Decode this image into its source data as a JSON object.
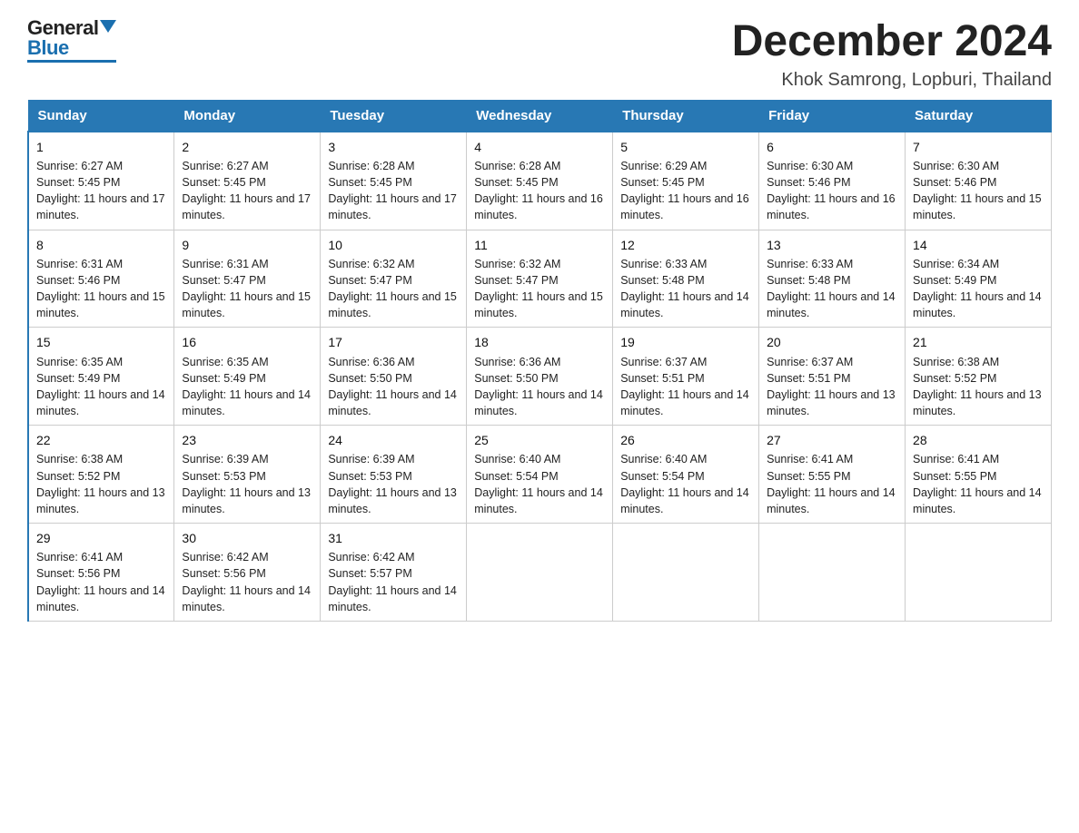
{
  "logo": {
    "general": "General",
    "blue": "Blue"
  },
  "header": {
    "month": "December 2024",
    "location": "Khok Samrong, Lopburi, Thailand"
  },
  "weekdays": [
    "Sunday",
    "Monday",
    "Tuesday",
    "Wednesday",
    "Thursday",
    "Friday",
    "Saturday"
  ],
  "weeks": [
    [
      {
        "day": "1",
        "sunrise": "6:27 AM",
        "sunset": "5:45 PM",
        "daylight": "11 hours and 17 minutes."
      },
      {
        "day": "2",
        "sunrise": "6:27 AM",
        "sunset": "5:45 PM",
        "daylight": "11 hours and 17 minutes."
      },
      {
        "day": "3",
        "sunrise": "6:28 AM",
        "sunset": "5:45 PM",
        "daylight": "11 hours and 17 minutes."
      },
      {
        "day": "4",
        "sunrise": "6:28 AM",
        "sunset": "5:45 PM",
        "daylight": "11 hours and 16 minutes."
      },
      {
        "day": "5",
        "sunrise": "6:29 AM",
        "sunset": "5:45 PM",
        "daylight": "11 hours and 16 minutes."
      },
      {
        "day": "6",
        "sunrise": "6:30 AM",
        "sunset": "5:46 PM",
        "daylight": "11 hours and 16 minutes."
      },
      {
        "day": "7",
        "sunrise": "6:30 AM",
        "sunset": "5:46 PM",
        "daylight": "11 hours and 15 minutes."
      }
    ],
    [
      {
        "day": "8",
        "sunrise": "6:31 AM",
        "sunset": "5:46 PM",
        "daylight": "11 hours and 15 minutes."
      },
      {
        "day": "9",
        "sunrise": "6:31 AM",
        "sunset": "5:47 PM",
        "daylight": "11 hours and 15 minutes."
      },
      {
        "day": "10",
        "sunrise": "6:32 AM",
        "sunset": "5:47 PM",
        "daylight": "11 hours and 15 minutes."
      },
      {
        "day": "11",
        "sunrise": "6:32 AM",
        "sunset": "5:47 PM",
        "daylight": "11 hours and 15 minutes."
      },
      {
        "day": "12",
        "sunrise": "6:33 AM",
        "sunset": "5:48 PM",
        "daylight": "11 hours and 14 minutes."
      },
      {
        "day": "13",
        "sunrise": "6:33 AM",
        "sunset": "5:48 PM",
        "daylight": "11 hours and 14 minutes."
      },
      {
        "day": "14",
        "sunrise": "6:34 AM",
        "sunset": "5:49 PM",
        "daylight": "11 hours and 14 minutes."
      }
    ],
    [
      {
        "day": "15",
        "sunrise": "6:35 AM",
        "sunset": "5:49 PM",
        "daylight": "11 hours and 14 minutes."
      },
      {
        "day": "16",
        "sunrise": "6:35 AM",
        "sunset": "5:49 PM",
        "daylight": "11 hours and 14 minutes."
      },
      {
        "day": "17",
        "sunrise": "6:36 AM",
        "sunset": "5:50 PM",
        "daylight": "11 hours and 14 minutes."
      },
      {
        "day": "18",
        "sunrise": "6:36 AM",
        "sunset": "5:50 PM",
        "daylight": "11 hours and 14 minutes."
      },
      {
        "day": "19",
        "sunrise": "6:37 AM",
        "sunset": "5:51 PM",
        "daylight": "11 hours and 14 minutes."
      },
      {
        "day": "20",
        "sunrise": "6:37 AM",
        "sunset": "5:51 PM",
        "daylight": "11 hours and 13 minutes."
      },
      {
        "day": "21",
        "sunrise": "6:38 AM",
        "sunset": "5:52 PM",
        "daylight": "11 hours and 13 minutes."
      }
    ],
    [
      {
        "day": "22",
        "sunrise": "6:38 AM",
        "sunset": "5:52 PM",
        "daylight": "11 hours and 13 minutes."
      },
      {
        "day": "23",
        "sunrise": "6:39 AM",
        "sunset": "5:53 PM",
        "daylight": "11 hours and 13 minutes."
      },
      {
        "day": "24",
        "sunrise": "6:39 AM",
        "sunset": "5:53 PM",
        "daylight": "11 hours and 13 minutes."
      },
      {
        "day": "25",
        "sunrise": "6:40 AM",
        "sunset": "5:54 PM",
        "daylight": "11 hours and 14 minutes."
      },
      {
        "day": "26",
        "sunrise": "6:40 AM",
        "sunset": "5:54 PM",
        "daylight": "11 hours and 14 minutes."
      },
      {
        "day": "27",
        "sunrise": "6:41 AM",
        "sunset": "5:55 PM",
        "daylight": "11 hours and 14 minutes."
      },
      {
        "day": "28",
        "sunrise": "6:41 AM",
        "sunset": "5:55 PM",
        "daylight": "11 hours and 14 minutes."
      }
    ],
    [
      {
        "day": "29",
        "sunrise": "6:41 AM",
        "sunset": "5:56 PM",
        "daylight": "11 hours and 14 minutes."
      },
      {
        "day": "30",
        "sunrise": "6:42 AM",
        "sunset": "5:56 PM",
        "daylight": "11 hours and 14 minutes."
      },
      {
        "day": "31",
        "sunrise": "6:42 AM",
        "sunset": "5:57 PM",
        "daylight": "11 hours and 14 minutes."
      },
      null,
      null,
      null,
      null
    ]
  ]
}
